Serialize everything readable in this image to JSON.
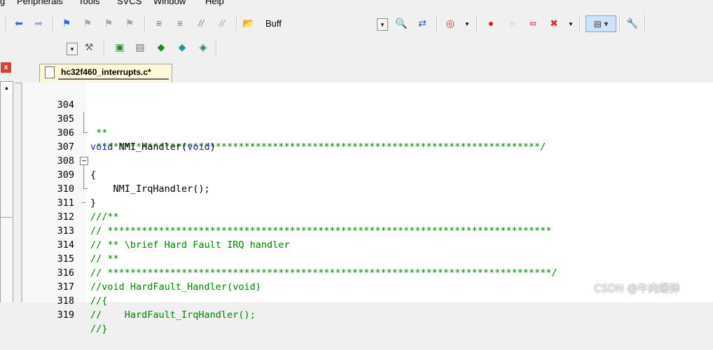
{
  "menu": {
    "items": [
      "g",
      "Peripherals",
      "Tools",
      "SVCS",
      "Window",
      "Help"
    ]
  },
  "toolbar": {
    "buff_label": "Buff"
  },
  "tab": {
    "title": "hc32f460_interrupts.c*"
  },
  "close_label": "x",
  "editor": {
    "lines": [
      {
        "num": "304",
        "text": " **",
        "style": "c"
      },
      {
        "num": "305",
        "text": " ******************************************************************************/",
        "style": "c"
      },
      {
        "num": "306",
        "kw1": "void",
        "mid": " NMI_Handler(",
        "kw2": "void",
        "end": ")",
        "style": "mixed"
      },
      {
        "num": "307",
        "text": "{",
        "style": "n"
      },
      {
        "num": "308",
        "text": "    NMI_IrqHandler();",
        "style": "n"
      },
      {
        "num": "309",
        "text": "}",
        "style": "n"
      },
      {
        "num": "310",
        "text": "",
        "style": "n"
      },
      {
        "num": "311",
        "text": "///**",
        "style": "c"
      },
      {
        "num": "312",
        "text": "// ******************************************************************************",
        "style": "c"
      },
      {
        "num": "313",
        "text": "// ** \\brief Hard Fault IRQ handler",
        "style": "c"
      },
      {
        "num": "314",
        "text": "// **",
        "style": "c"
      },
      {
        "num": "315",
        "text": "// ******************************************************************************/",
        "style": "c"
      },
      {
        "num": "316",
        "text": "//void HardFault_Handler(void)",
        "style": "c"
      },
      {
        "num": "317",
        "text": "//{",
        "style": "c"
      },
      {
        "num": "318",
        "text": "//    HardFault_IrqHandler();",
        "style": "c"
      },
      {
        "num": "319",
        "text": "//}",
        "style": "c"
      }
    ]
  },
  "watermark": "CSDN @牛肉爆弹",
  "colors": {
    "keyword": "#1a1aa6",
    "comment": "#008000",
    "tab_bg": "#fff8d8"
  }
}
